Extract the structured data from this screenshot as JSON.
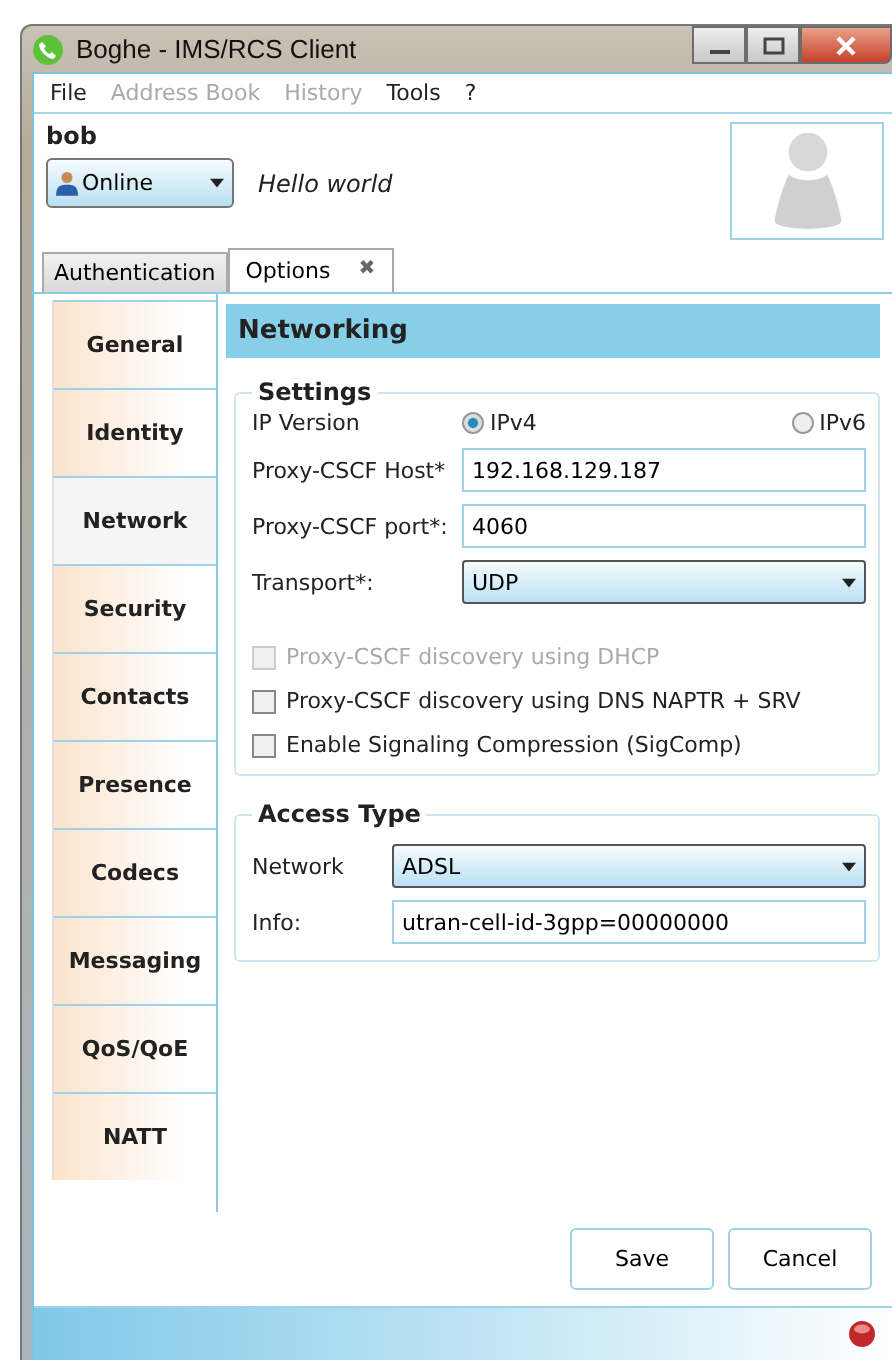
{
  "window": {
    "title": "Boghe - IMS/RCS Client"
  },
  "menu": [
    {
      "label": "File",
      "disabled": false
    },
    {
      "label": "Address Book",
      "disabled": true
    },
    {
      "label": "History",
      "disabled": true
    },
    {
      "label": "Tools",
      "disabled": false
    },
    {
      "label": "?",
      "disabled": false
    }
  ],
  "user": {
    "name": "bob",
    "status": "Online",
    "note": "Hello world"
  },
  "tabs": [
    {
      "label": "Authentication",
      "selected": false,
      "closable": false
    },
    {
      "label": "Options",
      "selected": true,
      "closable": true,
      "close_glyph": "✖"
    }
  ],
  "sidebar": {
    "items": [
      {
        "label": "General",
        "selected": false
      },
      {
        "label": "Identity",
        "selected": false
      },
      {
        "label": "Network",
        "selected": true
      },
      {
        "label": "Security",
        "selected": false
      },
      {
        "label": "Contacts",
        "selected": false
      },
      {
        "label": "Presence",
        "selected": false
      },
      {
        "label": "Codecs",
        "selected": false
      },
      {
        "label": "Messaging",
        "selected": false
      },
      {
        "label": "QoS/QoE",
        "selected": false
      },
      {
        "label": "NATT",
        "selected": false
      }
    ]
  },
  "panel": {
    "title": "Networking",
    "settings": {
      "title": "Settings",
      "ip_version_label": "IP Version",
      "ip_versions": [
        {
          "label": "IPv4",
          "selected": true
        },
        {
          "label": "IPv6",
          "selected": false
        }
      ],
      "fields": [
        {
          "kind": "text",
          "label": "Proxy-CSCF Host*",
          "value": "192.168.129.187"
        },
        {
          "kind": "text",
          "label": "Proxy-CSCF port*:",
          "value": "4060"
        },
        {
          "kind": "select",
          "label": "Transport*:",
          "value": "UDP"
        }
      ],
      "checkboxes": [
        {
          "label": "Proxy-CSCF discovery using DHCP",
          "checked": false,
          "disabled": true
        },
        {
          "label": "Proxy-CSCF discovery using DNS NAPTR + SRV",
          "checked": false,
          "disabled": false
        },
        {
          "label": "Enable Signaling Compression (SigComp)",
          "checked": false,
          "disabled": false
        }
      ]
    },
    "access": {
      "title": "Access Type",
      "fields": [
        {
          "kind": "select",
          "label": "Network",
          "value": "ADSL"
        },
        {
          "kind": "text",
          "label": "Info:",
          "value": "utran-cell-id-3gpp=00000000"
        }
      ]
    }
  },
  "buttons": [
    "Save",
    "Cancel"
  ]
}
